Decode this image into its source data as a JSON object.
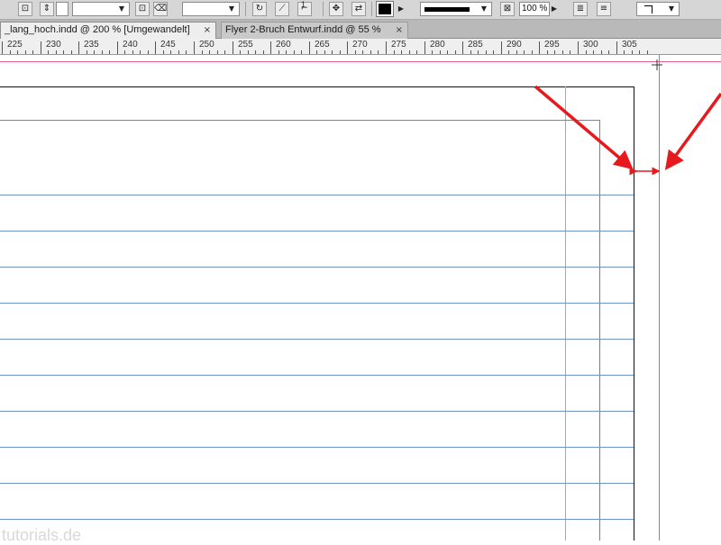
{
  "toolbar": {
    "zoom_value": "100 %",
    "icons": [
      "link-icon",
      "spin-arrows-icon",
      "eraser-icon",
      "rotate-icon",
      "shear-icon",
      "reference-point-icon",
      "flip-icon",
      "fill-swatch-icon",
      "stroke-type-icon",
      "fit-frame-icon",
      "corner-icon"
    ],
    "reference_superscript": "1"
  },
  "tabs": [
    {
      "label": "_lang_hoch.indd @ 200 % [Umgewandelt]",
      "close": "×",
      "active": true
    },
    {
      "label": "Flyer 2-Bruch Entwurf.indd @ 55 %",
      "close": "×",
      "active": false
    }
  ],
  "ruler": {
    "labels": [
      "225",
      "230",
      "235",
      "240",
      "245",
      "250",
      "255",
      "260",
      "265",
      "270",
      "275",
      "280",
      "285",
      "290",
      "295",
      "300",
      "305"
    ]
  },
  "colors": {
    "bleed_guide": "#e0608a",
    "margin_guide": "#d050c8",
    "column_guide": "#3cd8c8",
    "baseline_grid": "#6c94c8",
    "annotation_arrow": "#e8191c"
  },
  "watermark": "tutorials.de"
}
